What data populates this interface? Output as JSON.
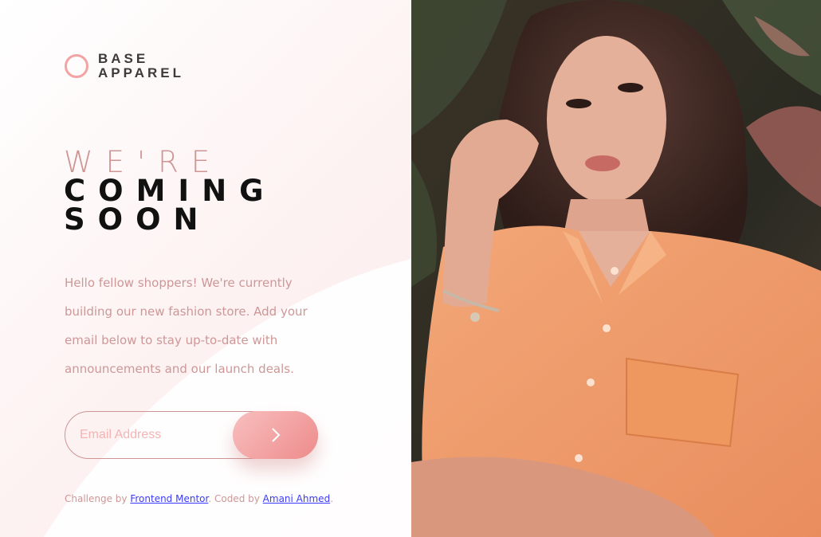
{
  "brand": {
    "line1": "BASE",
    "line2": "APPAREL"
  },
  "hero": {
    "line1": "WE'RE",
    "line2": "COMING",
    "line3": "SOON",
    "text": "Hello fellow shoppers! We're currently building our new fashion store. Add your email below to stay up-to-date with announcements and our launch deals."
  },
  "form": {
    "email_placeholder": "Email Address",
    "submit_icon": "chevron-right-icon"
  },
  "footer": {
    "prefix": "Challenge by ",
    "link1": "Frontend Mentor",
    "middle": ". Coded by ",
    "link2": "Amani Ahmed",
    "suffix": "."
  },
  "colors": {
    "accent_pink": "#ce9797",
    "button_gradient_start": "#f8bfbf",
    "button_gradient_end": "#ee8b8b",
    "dark_text": "#111111"
  }
}
